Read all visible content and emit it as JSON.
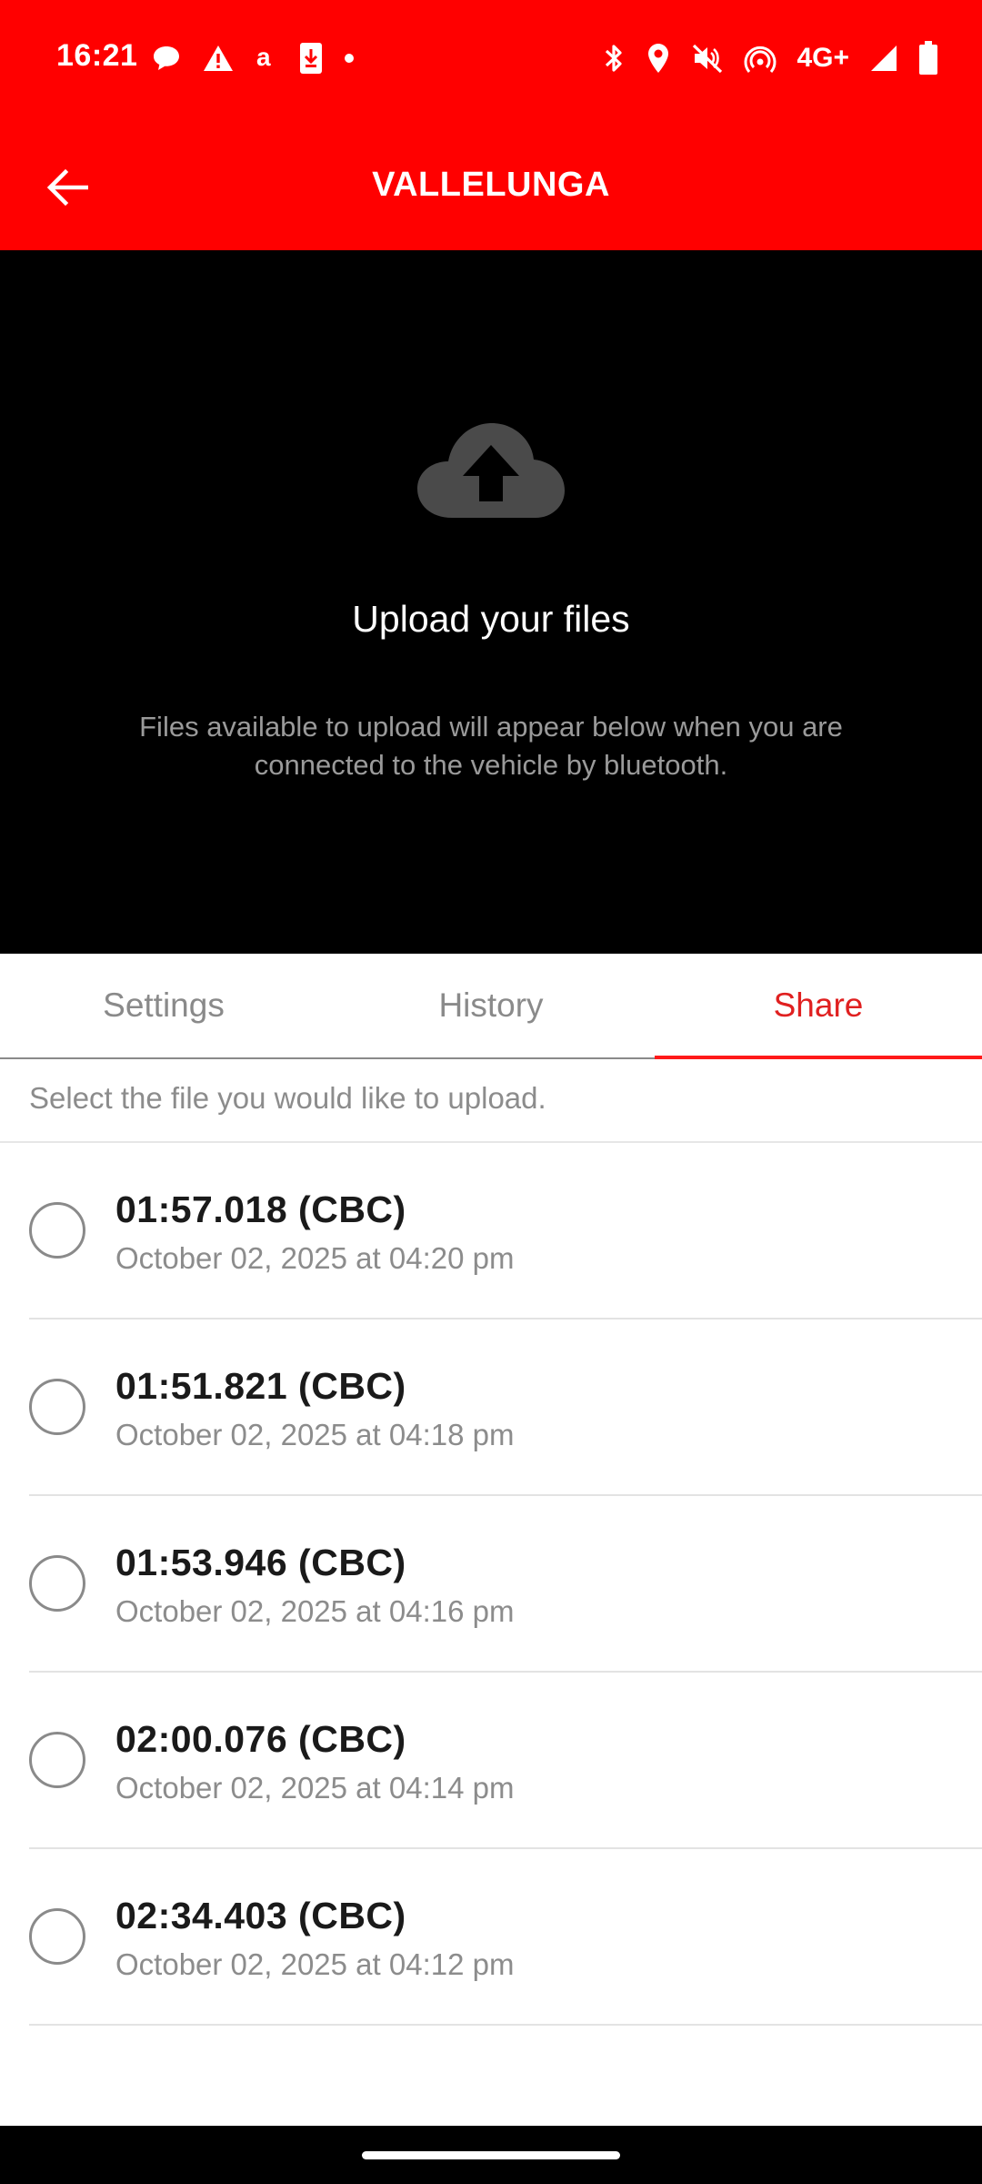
{
  "status_bar": {
    "time": "16:21",
    "network": "4G+",
    "left_icons": [
      "chat-bubble-icon",
      "warning-icon",
      "amazon-icon",
      "download-icon",
      "dot-icon"
    ],
    "right_icons": [
      "bluetooth-icon",
      "location-icon",
      "mute-icon",
      "hotspot-icon",
      "signal-icon",
      "battery-icon"
    ]
  },
  "app_bar": {
    "title": "VALLELUNGA",
    "back_icon": "arrow-left-icon"
  },
  "hero": {
    "icon": "cloud-upload-icon",
    "title": "Upload your files",
    "description": "Files available to upload will appear below when you are connected to the vehicle by bluetooth."
  },
  "tabs": [
    {
      "label": "Settings",
      "active": false
    },
    {
      "label": "History",
      "active": false
    },
    {
      "label": "Share",
      "active": true
    }
  ],
  "instruction": "Select the file you would like to upload.",
  "files": [
    {
      "time": "01:57.018 (CBC)",
      "date": "October 02, 2025 at 04:20 pm",
      "selected": false
    },
    {
      "time": "01:51.821 (CBC)",
      "date": "October 02, 2025 at 04:18 pm",
      "selected": false
    },
    {
      "time": "01:53.946 (CBC)",
      "date": "October 02, 2025 at 04:16 pm",
      "selected": false
    },
    {
      "time": "02:00.076 (CBC)",
      "date": "October 02, 2025 at 04:14 pm",
      "selected": false
    },
    {
      "time": "02:34.403 (CBC)",
      "date": "October 02, 2025 at 04:12 pm",
      "selected": false
    }
  ],
  "colors": {
    "brand_red": "#ff0000",
    "active_tab": "#e02020",
    "hero_background": "#000000",
    "muted_text": "#8c8c8c"
  }
}
